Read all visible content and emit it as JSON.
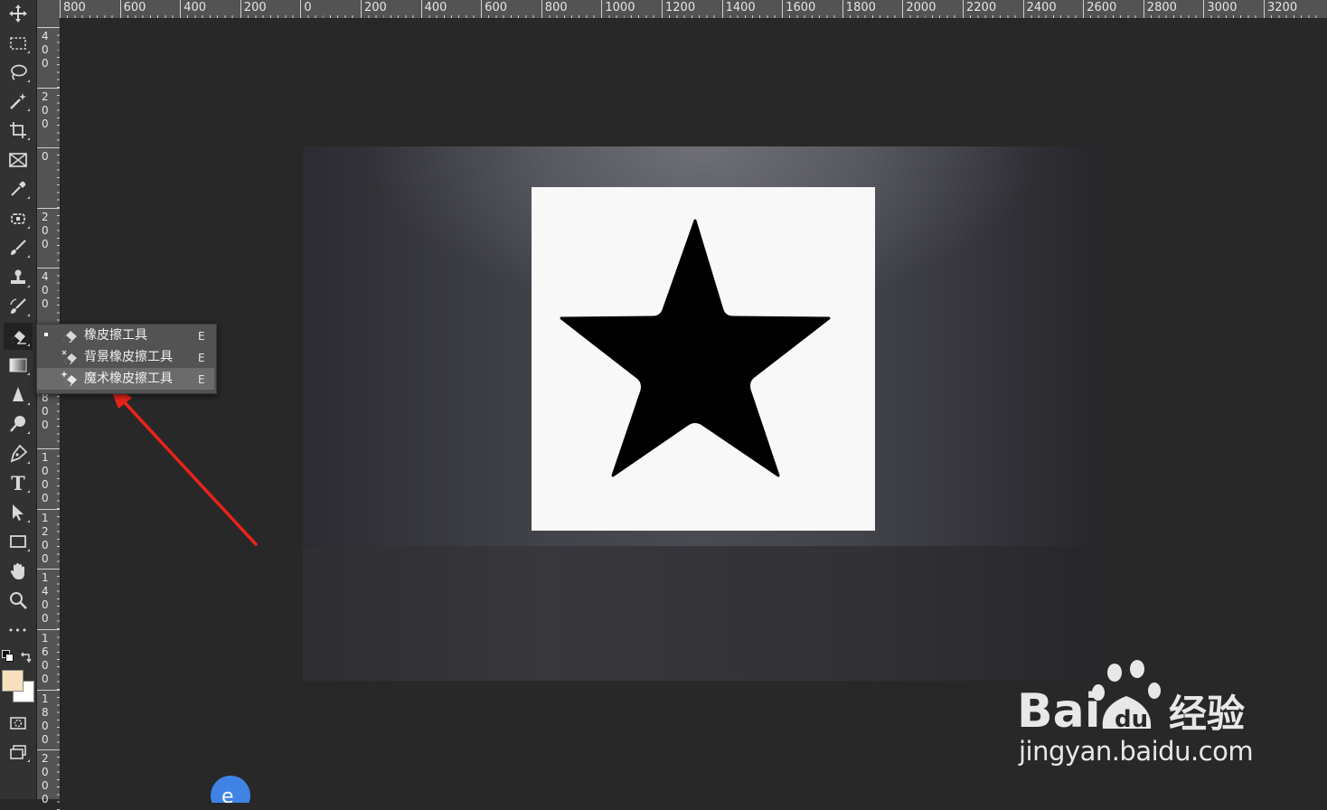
{
  "ruler_top": [
    "800",
    "600",
    "400",
    "200",
    "0",
    "200",
    "400",
    "600",
    "800",
    "1000",
    "1200",
    "1400",
    "1600",
    "1800",
    "2000",
    "2200",
    "2400",
    "2600",
    "2800",
    "3000",
    "3200"
  ],
  "ruler_left": [
    "400",
    "200",
    "0",
    "200",
    "400",
    "600",
    "800",
    "1000",
    "1200",
    "1400",
    "1600",
    "1800",
    "2000"
  ],
  "toolbar": {
    "tools": [
      "move-tool",
      "rectangular-marquee-tool",
      "lasso-tool",
      "magic-wand-tool",
      "crop-tool",
      "frame-tool",
      "eyedropper-tool",
      "spot-healing-tool",
      "brush-tool",
      "clone-stamp-tool",
      "history-brush-tool",
      "eraser-tool",
      "gradient-tool",
      "blur-tool",
      "dodge-tool",
      "pen-tool",
      "type-tool",
      "path-selection-tool",
      "rectangle-tool",
      "hand-tool",
      "zoom-tool",
      "edit-toolbar"
    ],
    "type_glyph": "T",
    "more_glyph": "•••",
    "foreground_color": "#f7e1bd",
    "background_color": "#ffffff"
  },
  "flyout": {
    "items": [
      {
        "label": "橡皮擦工具",
        "shortcut": "E",
        "selected": true
      },
      {
        "label": "背景橡皮擦工具",
        "shortcut": "E",
        "selected": false
      },
      {
        "label": "魔术橡皮擦工具",
        "shortcut": "E",
        "selected": false
      }
    ]
  },
  "canvas": {
    "shape": "star",
    "shape_color": "#000000",
    "box_color": "#f8f8f8"
  },
  "annotation": {
    "arrow_color": "#e8231b"
  },
  "watermark": {
    "brand": "Bai",
    "brand_cn": "经验",
    "url": "jingyan.baidu.com"
  }
}
